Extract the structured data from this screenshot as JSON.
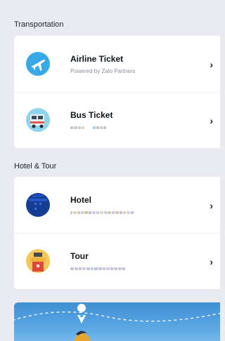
{
  "transportation": {
    "title": "Transportation",
    "items": [
      {
        "label": "Airline Ticket",
        "subtitle": "Powered by Zalo Partners",
        "icon": "airplane-icon",
        "color": "#38a9e6"
      },
      {
        "label": "Bus Ticket",
        "icon": "bus-icon",
        "color": "#e05a4f"
      }
    ]
  },
  "hotel_tour": {
    "title": "Hotel & Tour",
    "items": [
      {
        "label": "Hotel",
        "icon": "hotel-icon",
        "color": "#163c94"
      },
      {
        "label": "Tour",
        "icon": "tour-icon",
        "color": "#f2b43c"
      }
    ]
  },
  "chevron": "›"
}
